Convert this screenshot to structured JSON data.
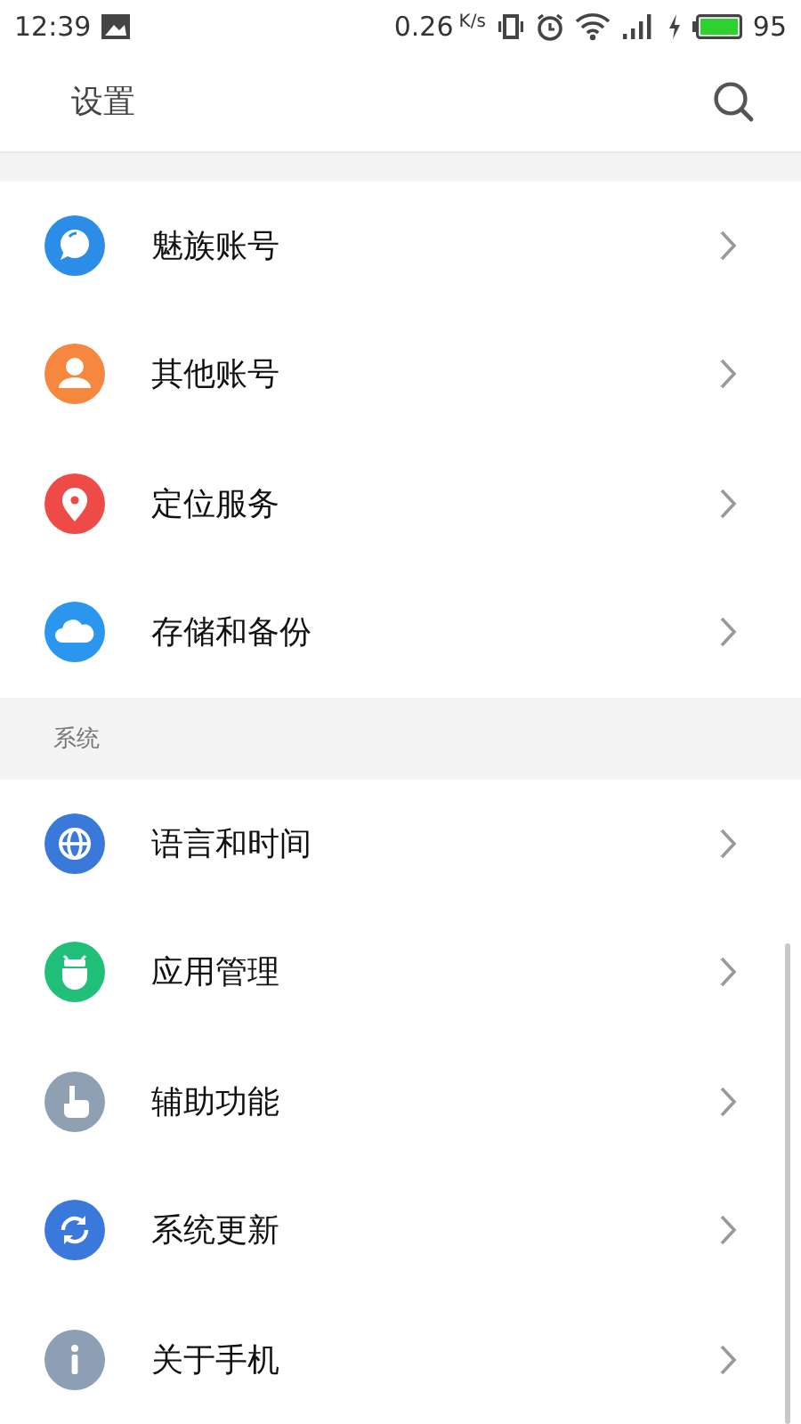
{
  "status_bar": {
    "time": "12:39",
    "speed": "0.26",
    "speed_unit": "K/s",
    "battery": "95"
  },
  "app_bar": {
    "title": "设置"
  },
  "sections": [
    {
      "items": [
        {
          "label": "魅族账号",
          "color": "#2b8de6"
        },
        {
          "label": "其他账号",
          "color": "#f5873f"
        },
        {
          "label": "定位服务",
          "color": "#ee4b48"
        },
        {
          "label": "存储和备份",
          "color": "#2a96ee"
        }
      ]
    },
    {
      "header": "系统",
      "items": [
        {
          "label": "语言和时间",
          "color": "#3a79d9"
        },
        {
          "label": "应用管理",
          "color": "#20c07a"
        },
        {
          "label": "辅助功能",
          "color": "#8fa0b3"
        },
        {
          "label": "系统更新",
          "color": "#3b78dc"
        },
        {
          "label": "关于手机",
          "color": "#8c9fb5"
        }
      ]
    }
  ]
}
